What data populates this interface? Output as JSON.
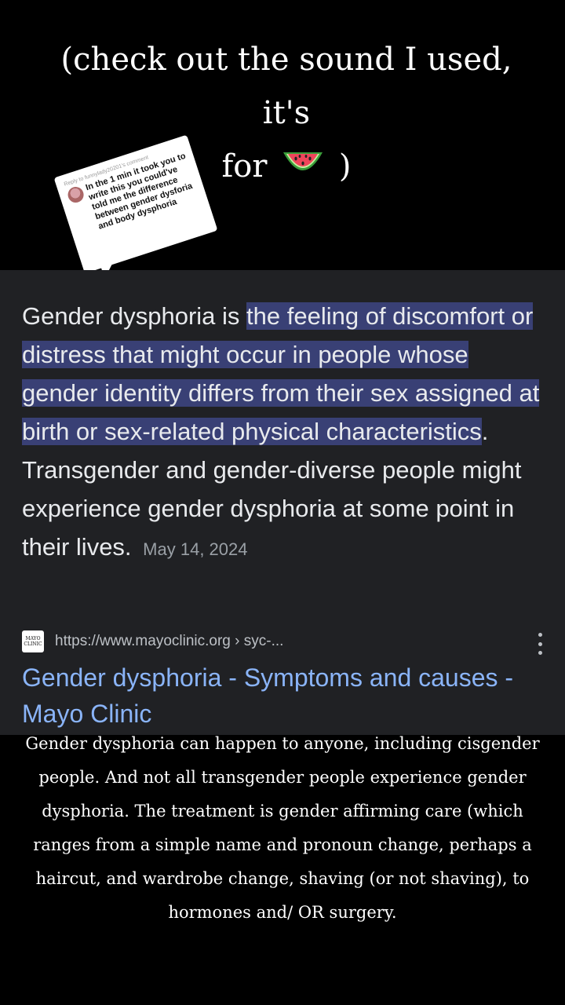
{
  "top_caption": {
    "line1": "(check out the sound I used, it's",
    "line2_prefix": "for",
    "emoji_name": "watermelon-emoji",
    "line2_suffix": ")"
  },
  "reply_card": {
    "label": "Reply to funnylady20201's comment",
    "text": "In the 1 min it took you to write this you could've told me the difference between gender dysforia and body dysphoria"
  },
  "search_result": {
    "snippet_prefix": "Gender dysphoria is ",
    "snippet_highlight": "the feeling of discomfort or distress that might occur in people whose gender identity differs from their sex assigned at birth or sex-related physical characteristics",
    "snippet_suffix": ". Transgender and gender-diverse people might experience gender dysphoria at some point in their lives.",
    "date": "May 14, 2024",
    "favicon_text": "MAYO CLINIC",
    "source_url": "https://www.mayoclinic.org › syc-...",
    "title": "Gender dysphoria - Symptoms and causes - Mayo Clinic"
  },
  "bottom_caption": "Gender dysphoria can happen to anyone, including cisgender people. And not all transgender people experience gender dysphoria. The treatment is gender affirming care (which ranges from a simple name and pronoun change, perhaps a haircut, and wardrobe change, shaving (or not shaving), to hormones and/ OR surgery.",
  "colors": {
    "panel_bg": "#202124",
    "highlight_bg": "#394075",
    "link_blue": "#8ab4f8"
  }
}
